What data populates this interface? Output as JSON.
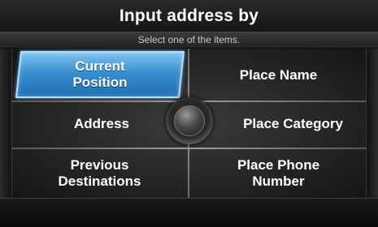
{
  "header": {
    "title": "Input address by",
    "subtitle": "Select one of the items."
  },
  "menu": {
    "current_position": "Current Position",
    "place_name": "Place Name",
    "address": "Address",
    "place_category": "Place Category",
    "previous_destinations": "Previous Destinations",
    "place_phone_number": "Place Phone Number"
  },
  "colors": {
    "selected_highlight": "#3a8fd0",
    "background": "#0c0c0c"
  },
  "icons": {
    "center_control": "joystick-knob-icon"
  },
  "state": {
    "selected_item": "Current Position"
  }
}
